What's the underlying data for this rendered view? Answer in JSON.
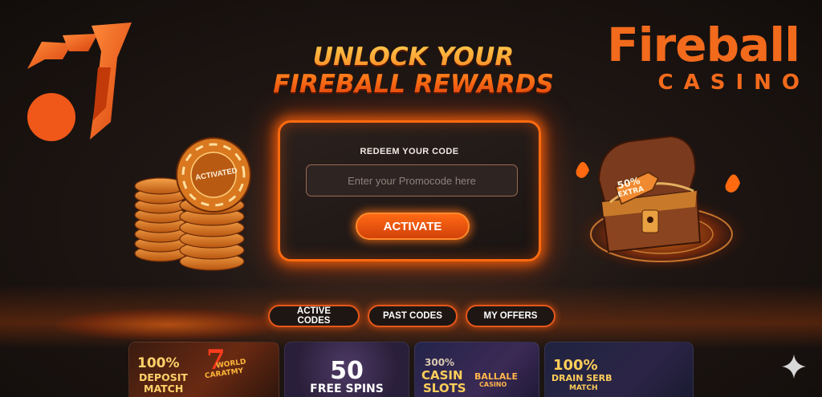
{
  "headline": {
    "line1": "UNLOCK YOUR",
    "line2": "FIREBALL REWARDS"
  },
  "brand": {
    "name": "Fireball",
    "sub": "CASINO"
  },
  "redeem": {
    "label": "REDEEM YOUR CODE",
    "input_placeholder": "Enter your Promocode here",
    "input_value": "",
    "button_label": "ACTIVATE"
  },
  "chips": {
    "label": "ACTIVATED"
  },
  "chest": {
    "tag_line1": "50%",
    "tag_line2": "EXTRA"
  },
  "tabs": [
    {
      "label": "ACTIVE CODES"
    },
    {
      "label": "PAST CODES"
    },
    {
      "label": "MY OFFERS"
    }
  ],
  "cards": [
    {
      "line1": "100%",
      "line2": "DEPOSIT",
      "line3": "MATCH",
      "art1": "WORLD",
      "art2": "CARATMY"
    },
    {
      "line1": "50",
      "line2": "FREE SPINS"
    },
    {
      "line1": "300%",
      "line2": "CASIN",
      "line3": "SLOTS",
      "art1": "BALLALE",
      "art2": "CASINO"
    },
    {
      "line1": "100%",
      "line2": "DRAIN SERB",
      "line3": "MATCH"
    }
  ],
  "colors": {
    "accent": "#f26a1c",
    "fire": "#ff6a10",
    "background": "#1a1412"
  },
  "icons": {
    "logo": "fireball-logo-icon",
    "sparkle": "sparkle-icon"
  }
}
